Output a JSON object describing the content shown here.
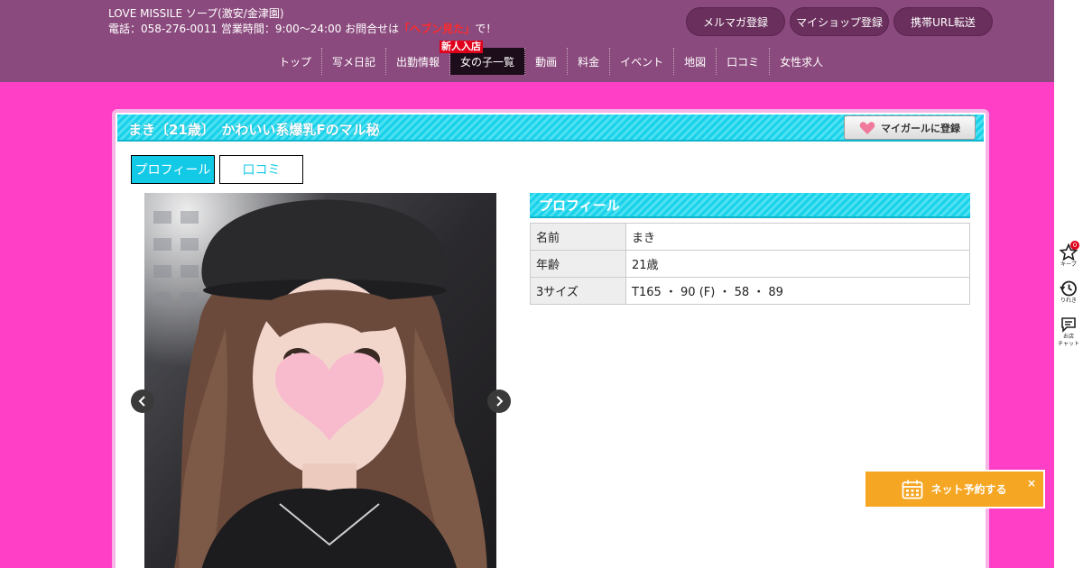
{
  "header": {
    "shop_name": "LOVE MISSILE ソープ(激安/金津園)",
    "contact_prefix": "電話：058-276-0011 営業時間：9:00～24:00 お問合せは",
    "contact_highlight": "「ヘブン見た」",
    "contact_suffix": "で！",
    "buttons": [
      "メルマガ登録",
      "マイショップ登録",
      "携帯URL転送"
    ]
  },
  "nav": {
    "new_badge": "新人入店",
    "items": [
      "トップ",
      "写メ日記",
      "出勤情報",
      "女の子一覧",
      "動画",
      "料金",
      "イベント",
      "地図",
      "口コミ",
      "女性求人"
    ],
    "active": "女の子一覧"
  },
  "profile_page": {
    "title": "まき〔21歳〕　かわいい系爆乳Fのマル秘",
    "mygirl_button": "マイガールに登録",
    "tabs": [
      "プロフィール",
      "口コミ"
    ],
    "section_title": "プロフィール",
    "rows": [
      {
        "key": "名前",
        "value": "まき"
      },
      {
        "key": "年齢",
        "value": "21歳"
      },
      {
        "key": "3サイズ",
        "value": "T165 ・ 90 (F) ・ 58 ・ 89"
      }
    ]
  },
  "side": {
    "keep_label": "キープ",
    "keep_count": "0",
    "history_label": "りれき",
    "chat_label_1": "お店",
    "chat_label_2": "チャット"
  },
  "reserve": {
    "label": "ネット予約する",
    "close": "×"
  },
  "colors": {
    "page_bg": "#ff3fc6",
    "header_bg": "#8b4a7d",
    "accent_cyan": "#18d2ea",
    "reserve_orange": "#f5a623"
  }
}
